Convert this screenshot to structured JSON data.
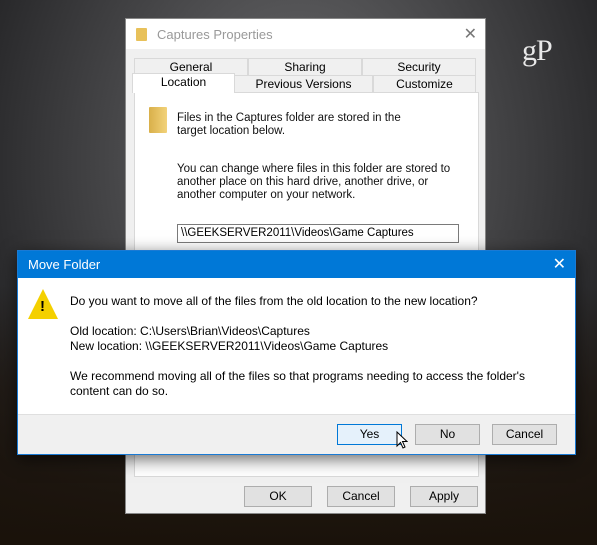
{
  "logo": "gP",
  "properties": {
    "title": "Captures Properties",
    "tabs_row1": [
      "General",
      "Sharing",
      "Security"
    ],
    "tabs_row2": [
      "Location",
      "Previous Versions",
      "Customize"
    ],
    "active_tab": "Location",
    "text1": "Files in the Captures folder are stored in the target location below.",
    "text2": "You can change where files in this folder are stored to another place on this hard drive, another drive, or another computer on your network.",
    "path": "\\\\GEEKSERVER2011\\Videos\\Game Captures",
    "ok": "OK",
    "cancel": "Cancel",
    "apply": "Apply"
  },
  "move_folder": {
    "title": "Move Folder",
    "question": "Do you want to move all of the files from the old location to the new location?",
    "old_location": "Old location: C:\\Users\\Brian\\Videos\\Captures",
    "new_location": "New location: \\\\GEEKSERVER2011\\Videos\\Game Captures",
    "recommend": "We recommend moving all of the files so that programs needing to access the folder's content can do so.",
    "yes": "Yes",
    "no": "No",
    "cancel": "Cancel"
  }
}
